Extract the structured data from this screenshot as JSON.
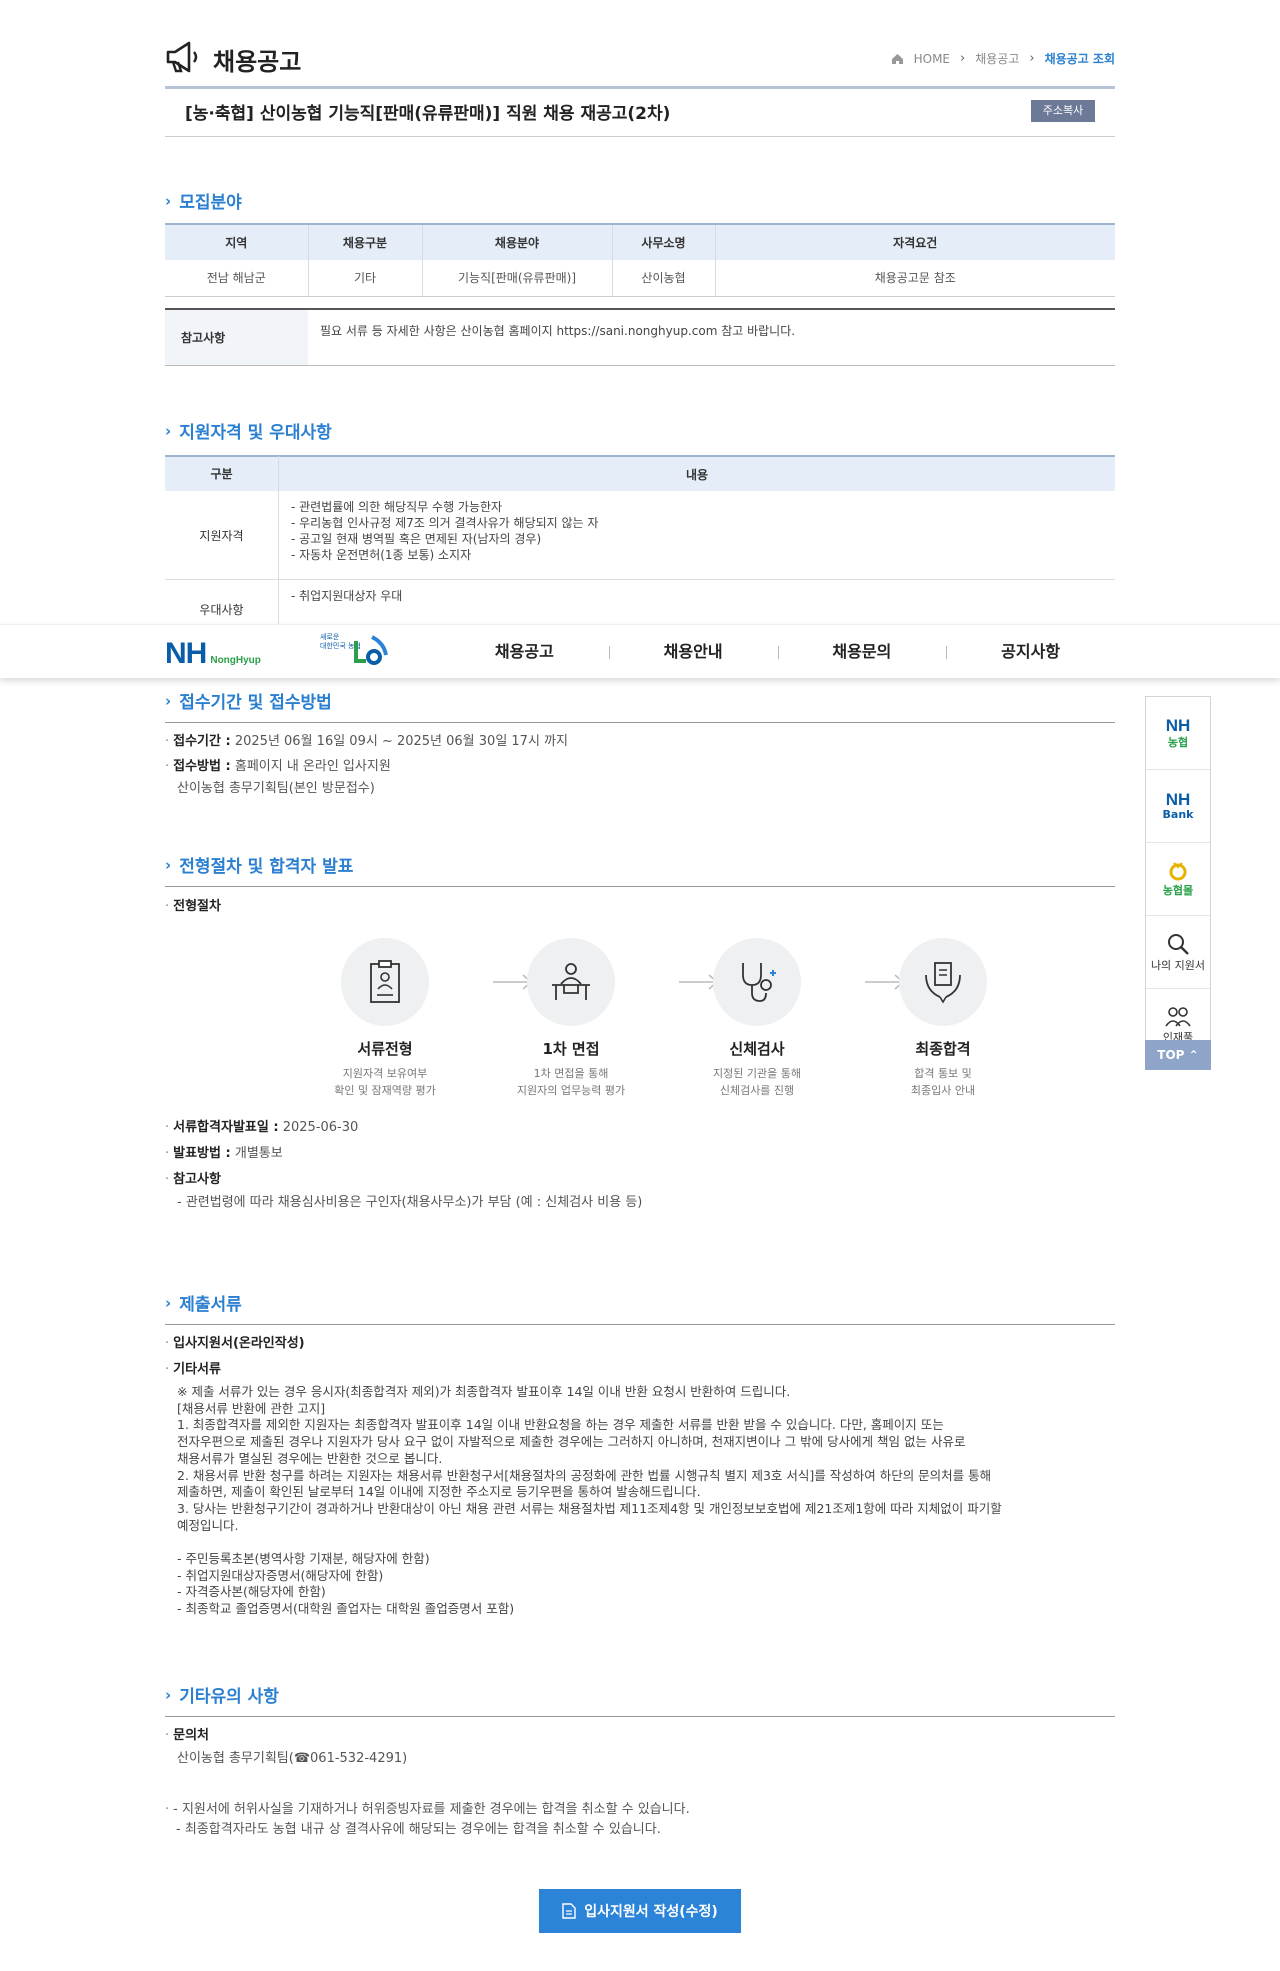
{
  "header": {
    "page_title": "채용공고",
    "breadcrumb": [
      "HOME",
      "채용공고",
      "채용공고 조회"
    ]
  },
  "posting": {
    "title": "[농·축협] 산이농협 기능직[판매(유류판매)] 직원 채용 재공고(2차)",
    "copy_button": "주소복사"
  },
  "recruit": {
    "heading": "모집분야",
    "columns": [
      "지역",
      "채용구분",
      "채용분야",
      "사무소명",
      "자격요건"
    ],
    "row": [
      "전남 해남군",
      "기타",
      "기능직[판매(유류판매)]",
      "산이농협",
      "채용공고문 참조"
    ],
    "ref_label": "참고사항",
    "ref_value": "필요 서류 등 자세한 사항은 산이농협 홈페이지 https://sani.nonghyup.com 참고 바랍니다."
  },
  "qualification": {
    "heading": "지원자격 및 우대사항",
    "col_type": "구분",
    "col_content": "내용",
    "rows": [
      {
        "key": "지원자격",
        "lines": [
          "- 관련법률에 의한 해당직무 수행 가능한자",
          "- 우리농협 인사규정 제7조 의거 결격사유가 해당되지 않는 자",
          "- 공고일 현재 병역필 혹은 면제된 자(남자의 경우)",
          "- 자동차 운전면허(1종 보통) 소지자"
        ]
      },
      {
        "key": "우대사항",
        "lines": [
          "- 취업지원대상자 우대"
        ]
      }
    ]
  },
  "gnb": {
    "logo_text": "NH",
    "logo_sub": "NongHyup",
    "logo_new": [
      "새로운",
      "대한민국 농협"
    ],
    "menu": [
      "채용공고",
      "채용안내",
      "채용문의",
      "공지사항"
    ]
  },
  "receipt": {
    "heading": "접수기간 및 접수방법",
    "period_label": "접수기간 :",
    "period_value": "2025년 06월 16일 09시 ~ 2025년 06월 30일 17시 까지",
    "method_label": "접수방법 :",
    "method_value": "홈페이지 내 온라인 입사지원",
    "method_value2": "산이농협 총무기획팀(본인 방문접수)"
  },
  "process": {
    "heading": "전형절차 및 합격자 발표",
    "sub_label": "전형절차",
    "steps": [
      {
        "name": "서류전형",
        "desc1": "지원자격 보유여부",
        "desc2": "확인 및 잠재역량 평가",
        "icon": "document-icon"
      },
      {
        "name": "1차 면접",
        "desc1": "1차 면접을 통해",
        "desc2": "지원자의 업무능력 평가",
        "icon": "interview-icon"
      },
      {
        "name": "신체검사",
        "desc1": "지정된 기관을 통해",
        "desc2": "신체검사를 진행",
        "icon": "stethoscope-icon"
      },
      {
        "name": "최종합격",
        "desc1": "합격 통보 및",
        "desc2": "최종입사 안내",
        "icon": "laurel-icon"
      }
    ],
    "announce_date_label": "서류합격자발표일 :",
    "announce_date_value": "2025-06-30",
    "announce_method_label": "발표방법 :",
    "announce_method_value": "개별통보",
    "note_label": "참고사항",
    "note_value": "- 관련법령에 따라 채용심사비용은 구인자(채용사무소)가 부담 (예 : 신체검사 비용 등)"
  },
  "documents": {
    "heading": "제출서류",
    "item1": "입사지원서(온라인작성)",
    "item2": "기타서류",
    "lines": [
      "※ 제출 서류가 있는 경우 응시자(최종합격자 제외)가 최종합격자 발표이후 14일 이내 반환 요청시 반환하여 드립니다.",
      "[채용서류 반환에 관한 고지]",
      " 1. 최종합격자를 제외한 지원자는 최종합격자 발표이후 14일 이내 반환요청을 하는 경우 제출한 서류를 반환 받을 수 있습니다. 다만, 홈페이지 또는",
      "전자우편으로 제출된 경우나 지원자가 당사 요구 없이 자발적으로 제출한 경우에는 그러하지 아니하며, 천재지변이나 그 밖에 당사에게 책임 없는 사유로",
      "채용서류가 멸실된 경우에는 반환한 것으로 봅니다.",
      " 2. 채용서류 반환 청구를 하려는 지원자는 채용서류 반환청구서[채용절차의 공정화에 관한 법률 시행규칙 별지 제3호 서식]를 작성하여 하단의 문의처를 통해",
      "제출하면, 제출이 확인된 날로부터 14일 이내에 지정한 주소지로 등기우편을 통하여 발송해드립니다.",
      " 3. 당사는 반환청구기간이 경과하거나 반환대상이 아닌 채용 관련 서류는 채용절차법 제11조제4항 및 개인정보보호법에 제21조제1항에 따라 지체없이 파기할",
      "예정입니다.",
      "",
      "- 주민등록초본(병역사항 기재분, 해당자에 한함)",
      "- 취업지원대상자증명서(해당자에 한함)",
      "- 자격증사본(해당자에 한함)",
      "- 최종학교 졸업증명서(대학원 졸업자는 대학원 졸업증명서 포함)"
    ]
  },
  "etc": {
    "heading": "기타유의 사항",
    "contact_label": "문의처",
    "contact_value": "산이농협 총무기획팀(☎061-532-4291)",
    "notes": [
      "- 지원서에 허위사실을 기재하거나 허위증빙자료를 제출한 경우에는 합격을 취소할 수 있습니다.",
      "- 최종합격자라도 농협 내규 상 결격사유에 해당되는 경우에는 합격을 취소할 수 있습니다."
    ]
  },
  "apply_button": "입사지원서 작성(수정)",
  "quick_menu": {
    "items": [
      {
        "nh": "NH",
        "sub": "농협"
      },
      {
        "nh": "NH",
        "sub": "Bank"
      },
      {
        "sub": "농협몰"
      },
      {
        "label": "나의 지원서"
      },
      {
        "label": "인재풀"
      }
    ],
    "top": "TOP"
  },
  "colors": {
    "accent": "#2b7fd0",
    "nh_blue": "#0a5da8",
    "nh_green": "#2aa04a"
  }
}
